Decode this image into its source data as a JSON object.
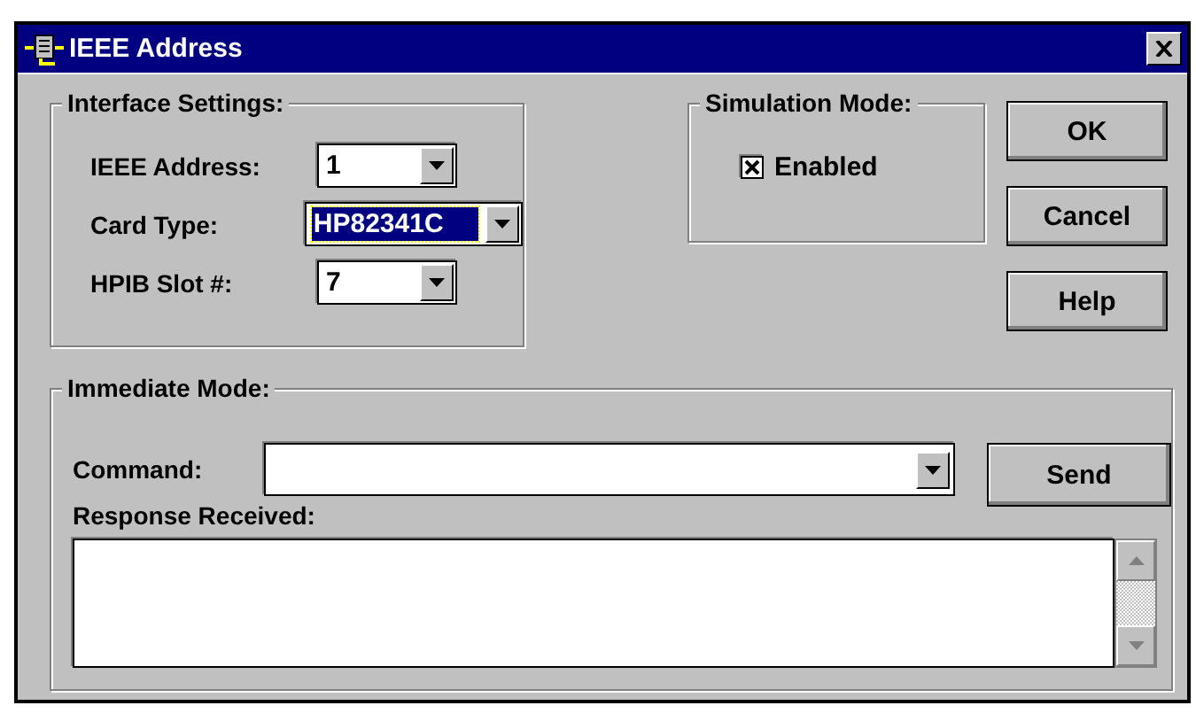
{
  "window": {
    "title": "IEEE Address"
  },
  "interface_settings": {
    "title": "Interface Settings:",
    "fields": [
      {
        "label": "IEEE Address:",
        "value": "1",
        "focused": false
      },
      {
        "label": "Card Type:",
        "value": "HP82341C",
        "focused": true
      },
      {
        "label": "HPIB Slot #:",
        "value": "7",
        "focused": false
      }
    ]
  },
  "simulation_mode": {
    "title": "Simulation Mode:",
    "checkbox": {
      "label": "Enabled",
      "checked": true
    }
  },
  "buttons": [
    "OK",
    "Cancel",
    "Help"
  ],
  "immediate_mode": {
    "title": "Immediate Mode:",
    "command_label": "Command:",
    "response_label": "Response Received:",
    "send_button": "Send"
  }
}
